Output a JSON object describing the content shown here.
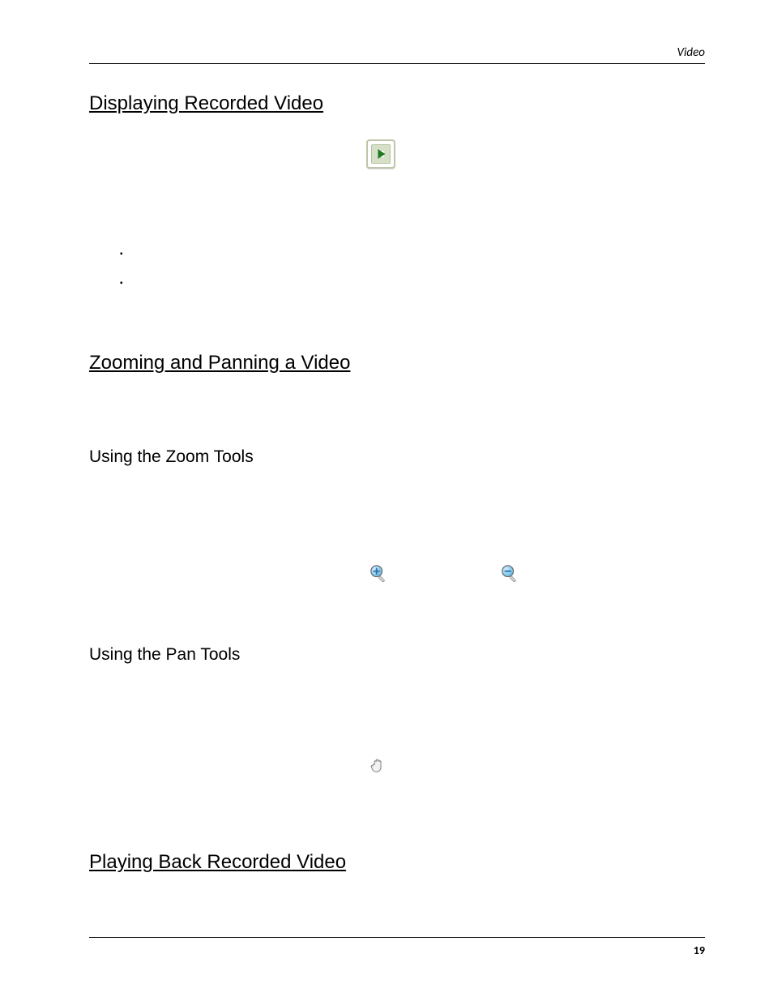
{
  "header": {
    "running_title": "Video"
  },
  "footer": {
    "page_number": "19"
  },
  "sections": {
    "display_recorded": {
      "heading": "Displaying Recorded Video"
    },
    "zoom_pan": {
      "heading": "Zooming and Panning a Video",
      "zoom_sub": "Using the Zoom Tools",
      "pan_sub": "Using the Pan Tools"
    },
    "playback": {
      "heading": "Playing Back Recorded Video"
    }
  },
  "icons": {
    "recorded_video": "recorded-video-play-icon",
    "zoom_in": "zoom-in-icon",
    "zoom_out": "zoom-out-icon",
    "pan": "pan-hand-icon"
  }
}
